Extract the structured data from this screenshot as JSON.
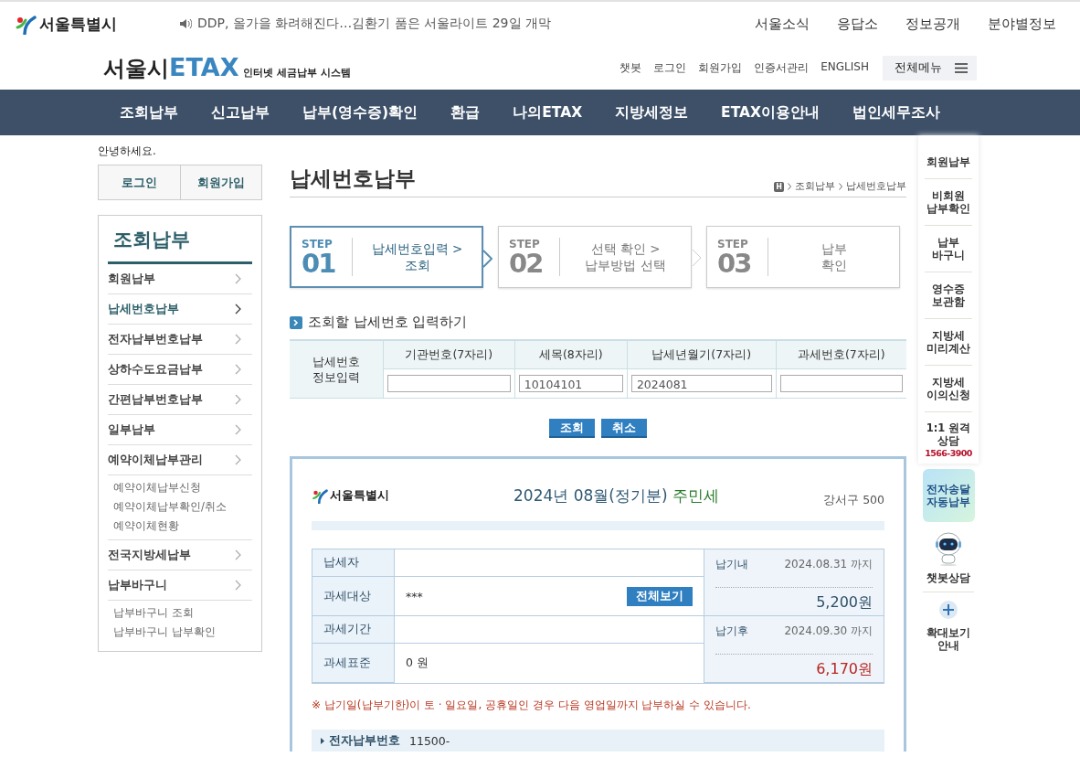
{
  "top_bar": {
    "logo": "서울특별시",
    "news": "DDP, 올가을 화려해진다…김환기 품은 서울라이트 29일 개막",
    "links": [
      "서울소식",
      "응답소",
      "정보공개",
      "분야별정보"
    ]
  },
  "header": {
    "logo_main": "서울시",
    "logo_brand": "ETAX",
    "logo_sub": "인터넷 세금납부 시스템",
    "links": [
      "챗봇",
      "로그인",
      "회원가입",
      "인증서관리",
      "ENGLISH"
    ],
    "menu_button": "전체메뉴"
  },
  "nav": [
    "조회납부",
    "신고납부",
    "납부(영수증)확인",
    "환급",
    "나의ETAX",
    "지방세정보",
    "ETAX이용안내",
    "법인세무조사"
  ],
  "sidebar": {
    "greeting": "안녕하세요.",
    "buttons": [
      "로그인",
      "회원가입"
    ],
    "title": "조회납부",
    "items": [
      {
        "label": "회원납부",
        "selected": false
      },
      {
        "label": "납세번호납부",
        "selected": true
      },
      {
        "label": "전자납부번호납부",
        "selected": false
      },
      {
        "label": "상하수도요금납부",
        "selected": false
      },
      {
        "label": "간편납부번호납부",
        "selected": false
      },
      {
        "label": "일부납부",
        "selected": false
      },
      {
        "label": "예약이체납부관리",
        "selected": false,
        "children": [
          "예약이체납부신청",
          "예약이체납부확인/취소",
          "예약이체현황"
        ]
      },
      {
        "label": "전국지방세납부",
        "selected": false
      },
      {
        "label": "납부바구니",
        "selected": false,
        "children": [
          "납부바구니 조회",
          "납부바구니 납부확인"
        ]
      }
    ]
  },
  "page": {
    "title": "납세번호납부",
    "home": "H",
    "breadcrumb": [
      "조회납부",
      "납세번호납부"
    ]
  },
  "steps": [
    {
      "label": "STEP",
      "number": "01",
      "lines": [
        "납세번호입력 >",
        "조회"
      ],
      "selected": true
    },
    {
      "label": "STEP",
      "number": "02",
      "lines": [
        "선택 확인 >",
        "납부방법 선택"
      ],
      "selected": false
    },
    {
      "label": "STEP",
      "number": "03",
      "lines": [
        "납부",
        "확인"
      ],
      "selected": false
    }
  ],
  "input_section": {
    "title": "조회할 납세번호 입력하기",
    "row_header": [
      "납세번호",
      "정보입력"
    ],
    "columns": [
      {
        "header": "기관번호(7자리)"
      },
      {
        "header": "세목(8자리)",
        "value": "10104101"
      },
      {
        "header": "납세년월기(7자리)",
        "value": "2024081"
      },
      {
        "header": "과세번호(7자리)"
      }
    ],
    "buttons": [
      "조회",
      "취소"
    ]
  },
  "bill": {
    "logo": "서울특별시",
    "title": "2024년 08월(정기분)",
    "tax_name": "주민세",
    "district": "강서구 500",
    "rows": [
      {
        "label": "납세자"
      },
      {
        "label": "과세대상",
        "value": "***",
        "button": "전체보기"
      },
      {
        "label": "과세기간"
      },
      {
        "label": "과세표준",
        "value": "0 원"
      }
    ],
    "due": [
      {
        "label": "납기내",
        "date": "2024.08.31 까지",
        "amount": "5,200원",
        "kind": "before"
      },
      {
        "label": "납기후",
        "date": "2024.09.30 까지",
        "amount": "6,170원",
        "kind": "after"
      }
    ],
    "notice": "※ 납기일(납부기한)이 토 · 일요일, 공휴일인 경우 다음 영업일까지 납부하실 수 있습니다.",
    "epay_label": "전자납부번호",
    "epay_value": "11500-"
  },
  "quick_menu": {
    "items": [
      [
        "회원납부"
      ],
      [
        "비회원",
        "납부확인"
      ],
      [
        "납부",
        "바구니"
      ],
      [
        "영수증",
        "보관함"
      ],
      [
        "지방세",
        "미리계산"
      ],
      [
        "지방세",
        "이의신청"
      ]
    ],
    "consult": [
      "1:1 원격",
      "상담"
    ],
    "phone": "1566-3900",
    "auto_pay": [
      "전자송달",
      "자동납부"
    ],
    "chatbot": "챗봇상담",
    "zoom": [
      "확대보기",
      "안내"
    ]
  }
}
